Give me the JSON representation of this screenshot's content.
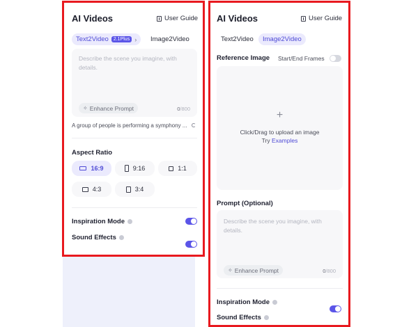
{
  "left": {
    "title": "AI Videos",
    "user_guide": "User Guide",
    "tabs": {
      "text2video": "Text2Video",
      "badge": "2.1Plus",
      "image2video": "Image2Video"
    },
    "prompt": {
      "placeholder_line1": "Describe the scene you imagine, with",
      "placeholder_line2": "details.",
      "enhance_label": "Enhance Prompt",
      "count": "0",
      "max": "/800"
    },
    "example_hint": "A group of people is performing a symphony ...",
    "aspect_ratio": {
      "label": "Aspect Ratio",
      "options": [
        "16:9",
        "9:16",
        "1:1",
        "4:3",
        "3:4"
      ],
      "selected": "16:9"
    },
    "inspiration_mode": {
      "label": "Inspiration Mode",
      "on": true
    },
    "sound_effects": {
      "label": "Sound Effects",
      "on": true
    }
  },
  "right": {
    "title": "AI Videos",
    "user_guide": "User Guide",
    "tabs": {
      "text2video": "Text2Video",
      "image2video": "Image2Video"
    },
    "reference_image": {
      "label": "Reference Image",
      "start_end_label": "Start/End Frames",
      "start_end_on": false
    },
    "upload": {
      "plus": "+",
      "text": "Click/Drag to upload an image",
      "try_prefix": "Try ",
      "examples_link": "Examples"
    },
    "prompt": {
      "label": "Prompt (Optional)",
      "placeholder_line1": "Describe the scene you imagine, with",
      "placeholder_line2": "details.",
      "enhance_label": "Enhance Prompt",
      "count": "0",
      "max": "/800"
    },
    "inspiration_mode": {
      "label": "Inspiration Mode",
      "on": true
    },
    "sound_effects": {
      "label": "Sound Effects",
      "on": false
    }
  },
  "colors": {
    "accent": "#5b55e8",
    "accent_light": "#ebeafd",
    "highlight_border": "#e8191f",
    "toggle_off": "#d6d8df"
  },
  "icons": [
    "book-icon",
    "chevron-right-icon",
    "wand-icon",
    "refresh-icon",
    "info-icon",
    "plus-icon"
  ]
}
